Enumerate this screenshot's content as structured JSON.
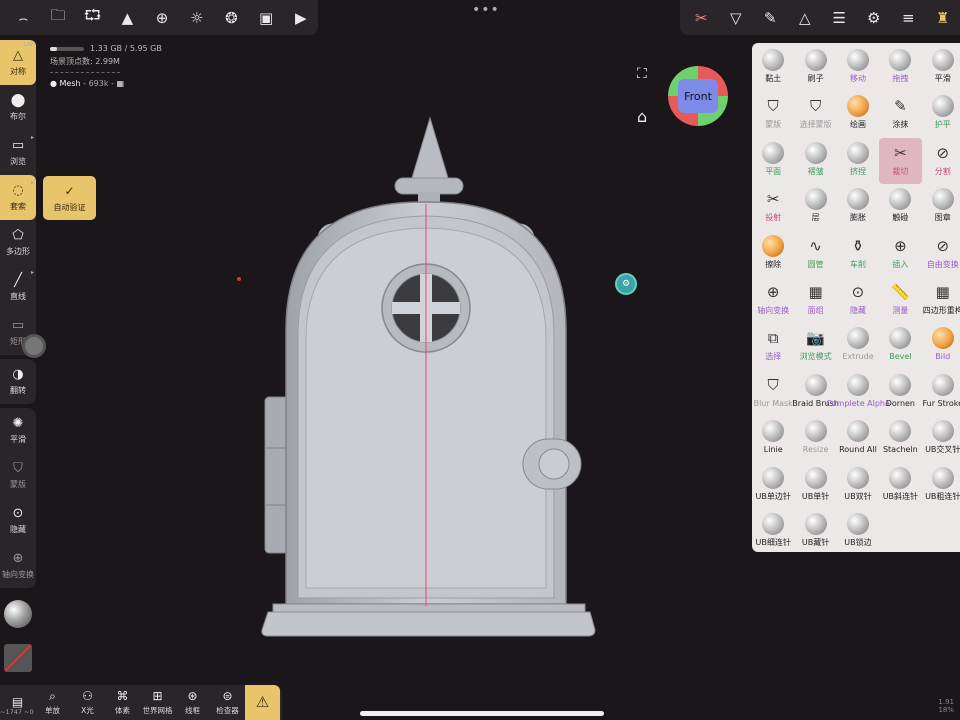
{
  "top_left_toolbar": {
    "icons": [
      "brush-tool-icon",
      "folder-icon",
      "share-icon",
      "scene-icon",
      "globe-icon",
      "sun-icon",
      "aperture-icon",
      "image-icon",
      "camera-icon"
    ]
  },
  "top_right_toolbar": {
    "icons": [
      "active-brush-icon",
      "filter-icon",
      "pen-icon",
      "symmetry-icon",
      "layers-icon",
      "settings-icon",
      "sliders-icon",
      "gold-castle-icon"
    ]
  },
  "stats": {
    "memory": "1.33 GB / 5.95 GB",
    "vertices_label": "场景顶点数: 2.99M",
    "mesh_name": "Mesh",
    "mesh_count": "- 693k -"
  },
  "left_tools": [
    {
      "name": "symmetry",
      "label": "对称",
      "icon": "△",
      "active": true,
      "corner": "L/W"
    },
    {
      "name": "boolean",
      "label": "布尔",
      "icon": "⬤"
    },
    {
      "name": "browse",
      "label": "浏览",
      "icon": "▭"
    },
    {
      "name": "lasso",
      "label": "套索",
      "icon": "◌",
      "active": true
    },
    {
      "name": "polygon",
      "label": "多边形",
      "icon": "⬠"
    },
    {
      "name": "line",
      "label": "直线",
      "icon": "╱"
    },
    {
      "name": "rectangle",
      "label": "矩形",
      "icon": "▭"
    },
    {
      "name": "flip",
      "label": "翻转",
      "icon": "◑"
    },
    {
      "name": "smooth",
      "label": "平滑",
      "icon": "✺"
    },
    {
      "name": "mask",
      "label": "蒙版",
      "icon": "⛉",
      "dim": true
    },
    {
      "name": "hide",
      "label": "隐藏",
      "icon": "⊙"
    },
    {
      "name": "axis-transform",
      "label": "轴向变换",
      "icon": "⊕",
      "dim": true
    }
  ],
  "popup": {
    "label": "自动验证",
    "icon": "✓"
  },
  "gizmo": {
    "face_label": "Front"
  },
  "brushes": [
    {
      "label": "黏土"
    },
    {
      "label": "刷子"
    },
    {
      "label": "移动",
      "style": "purple"
    },
    {
      "label": "拖拽",
      "style": "purple"
    },
    {
      "label": "平滑"
    },
    {
      "label": "蒙版",
      "style": "dim",
      "icon": "⛉"
    },
    {
      "label": "选择蒙版",
      "style": "dim",
      "icon": "⛉"
    },
    {
      "label": "绘画",
      "orange": true
    },
    {
      "label": "涂抹",
      "icon": "✎"
    },
    {
      "label": "护平",
      "style": "green"
    },
    {
      "label": "平面",
      "style": "green"
    },
    {
      "label": "褶皱",
      "style": "green"
    },
    {
      "label": "挤捏",
      "style": "green"
    },
    {
      "label": "裁切",
      "active": true,
      "icon": "✂"
    },
    {
      "label": "分割",
      "style": "pink",
      "icon": "⊘"
    },
    {
      "label": "投射",
      "style": "pink",
      "icon": "✂"
    },
    {
      "label": "层"
    },
    {
      "label": "膨胀"
    },
    {
      "label": "触碰"
    },
    {
      "label": "图章"
    },
    {
      "label": "擦除",
      "orange": true
    },
    {
      "label": "圆管",
      "style": "green",
      "icon": "∿"
    },
    {
      "label": "车削",
      "style": "green",
      "icon": "⚱"
    },
    {
      "label": "插入",
      "style": "green",
      "icon": "⊕"
    },
    {
      "label": "自由变换",
      "style": "purple",
      "icon": "⊘"
    },
    {
      "label": "轴向变换",
      "style": "purple",
      "icon": "⊕"
    },
    {
      "label": "面组",
      "style": "purple",
      "icon": "▦"
    },
    {
      "label": "隐藏",
      "style": "purple",
      "icon": "⊙"
    },
    {
      "label": "测量",
      "style": "purple",
      "icon": "📏"
    },
    {
      "label": "四边形重构",
      "icon": "▦"
    },
    {
      "label": "选择",
      "style": "purple",
      "icon": "⧉"
    },
    {
      "label": "浏览模式",
      "style": "green",
      "icon": "📷"
    },
    {
      "label": "Extrude",
      "style": "dim"
    },
    {
      "label": "Bevel",
      "style": "green"
    },
    {
      "label": "Bild",
      "style": "purple",
      "orange": true
    },
    {
      "label": "Blur Mask",
      "style": "dim",
      "icon": "⛉"
    },
    {
      "label": "Braid Brush"
    },
    {
      "label": "Complete Alpha",
      "style": "purple"
    },
    {
      "label": "Dornen"
    },
    {
      "label": "Fur Stroke"
    },
    {
      "label": "Linie"
    },
    {
      "label": "Resize",
      "style": "dim"
    },
    {
      "label": "Round All"
    },
    {
      "label": "Stacheln"
    },
    {
      "label": "UB交叉针"
    },
    {
      "label": "UB单边针"
    },
    {
      "label": "UB单针"
    },
    {
      "label": "UB双针"
    },
    {
      "label": "UB斜连针"
    },
    {
      "label": "UB粗连针"
    },
    {
      "label": "UB细连针"
    },
    {
      "label": "UB藏针"
    },
    {
      "label": "UB锁边"
    }
  ],
  "bottom_tools": [
    {
      "name": "bottom-menu",
      "label": "",
      "icon": "▤"
    },
    {
      "name": "single",
      "label": "单放",
      "icon": "⌕"
    },
    {
      "name": "xray",
      "label": "X光",
      "icon": "⚇"
    },
    {
      "name": "voxel",
      "label": "体素",
      "icon": "⌘"
    },
    {
      "name": "world-grid",
      "label": "世界网格",
      "icon": "⊞"
    },
    {
      "name": "wireframe",
      "label": "线框",
      "icon": "⊛"
    },
    {
      "name": "inspector",
      "label": "检查器",
      "icon": "⊜"
    },
    {
      "name": "warning",
      "label": "",
      "icon": "⚠",
      "warn": true
    }
  ],
  "bottom_stat": "~1747 ~0",
  "fps": "1.91\n18%",
  "colors": {
    "accent": "#e8c46a",
    "panel": "#2a2528",
    "brush_panel": "#ece8e8",
    "active_brush": "#e0b7c0"
  }
}
